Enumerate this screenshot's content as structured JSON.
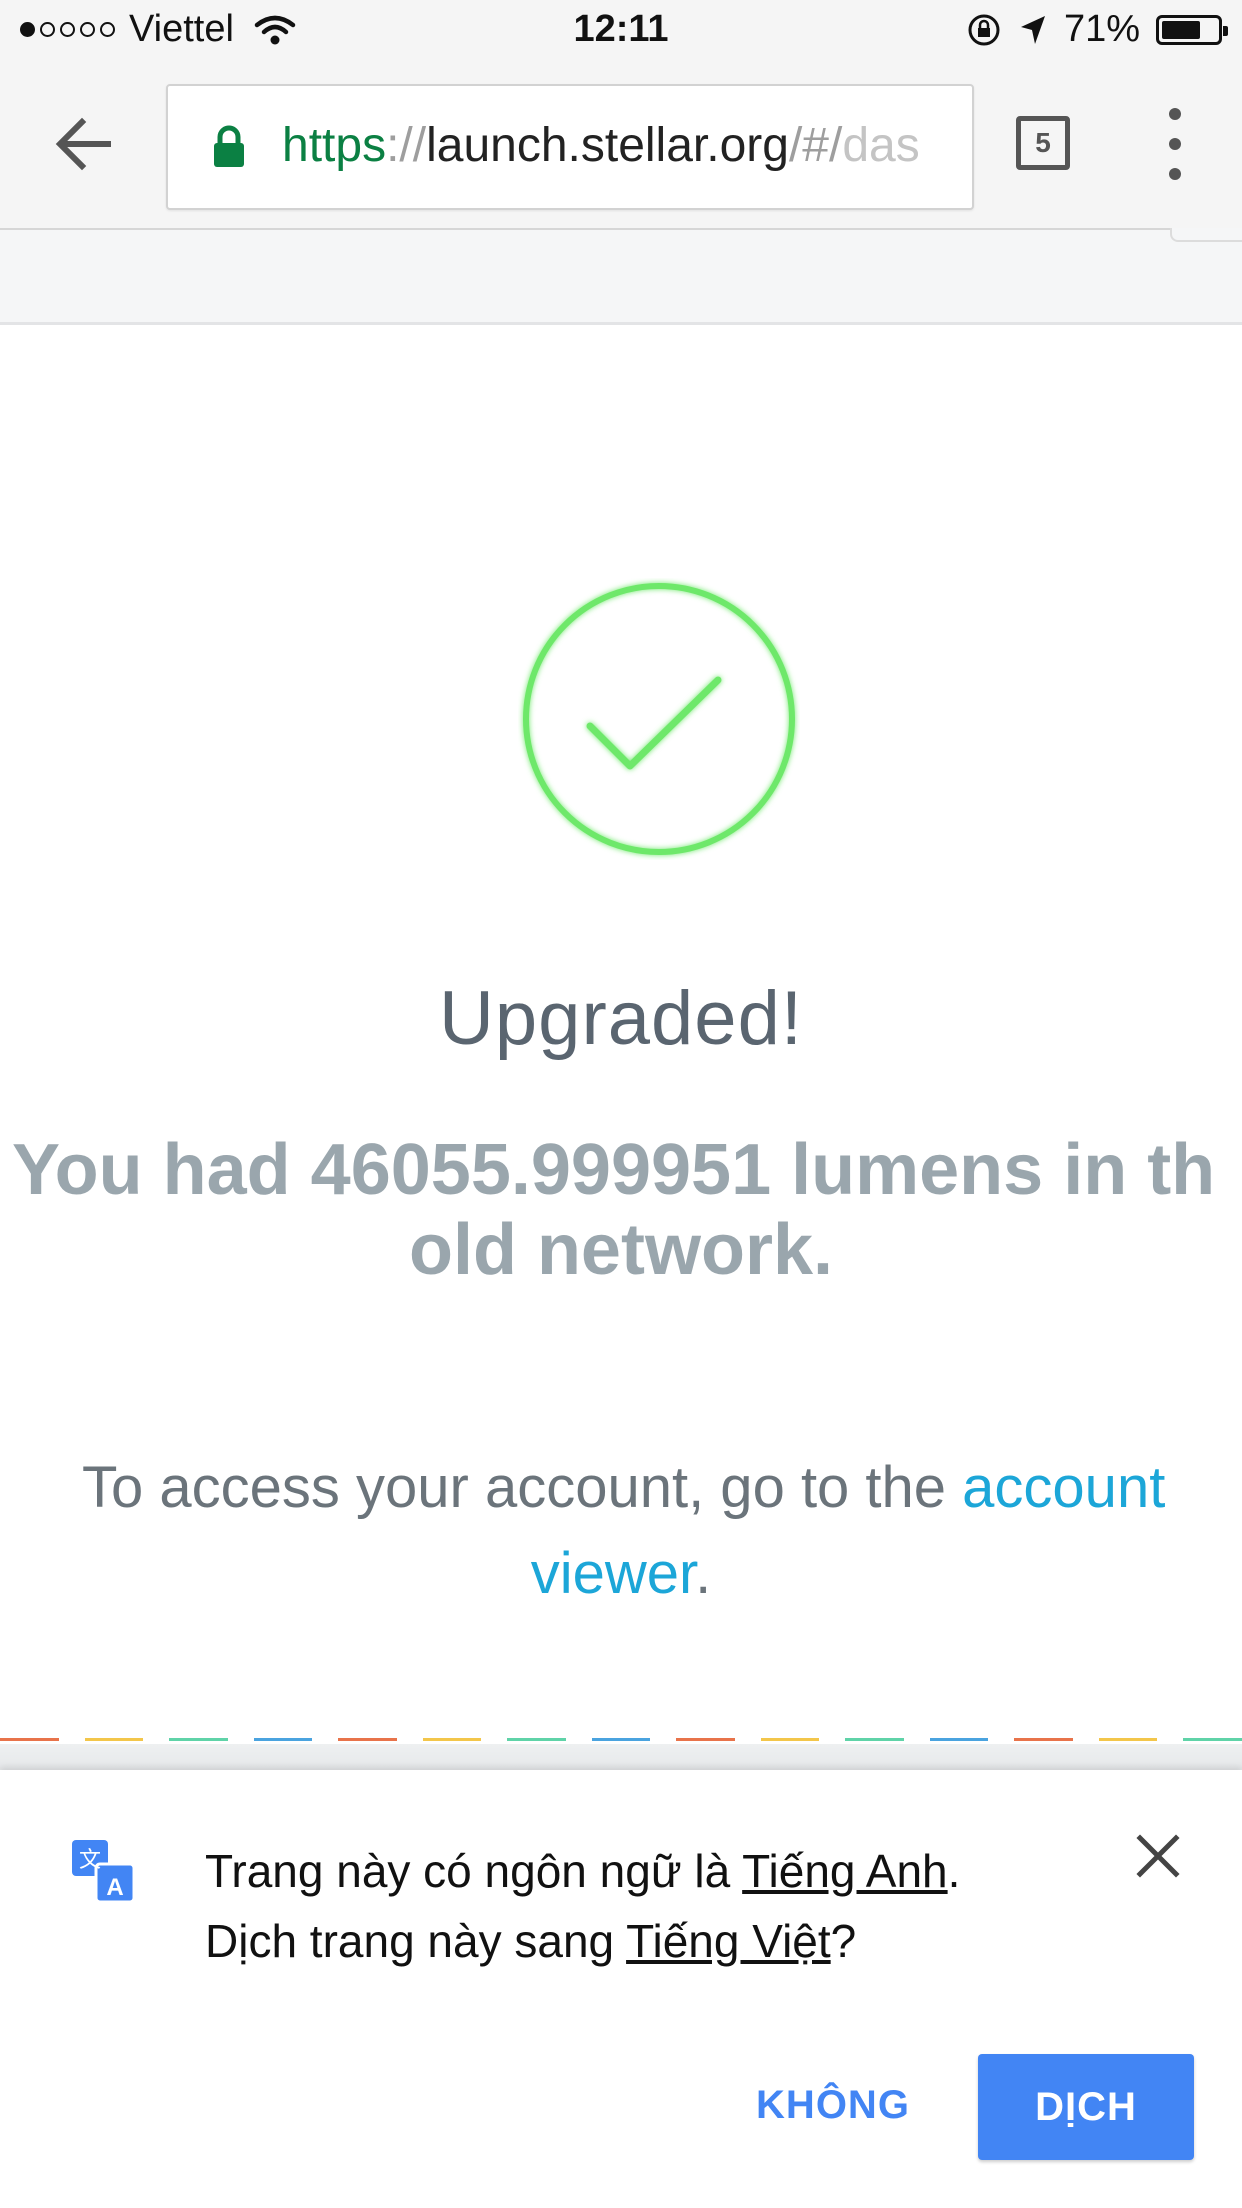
{
  "status_bar": {
    "carrier": "Viettel",
    "time": "12:11",
    "battery": "71%",
    "battery_level": 0.71,
    "signal_bars_filled": 1,
    "signal_bars_total": 5
  },
  "browser": {
    "url_scheme": "https",
    "url_sep1": "://",
    "url_host": "launch.stellar.org",
    "url_sep2": "/#/",
    "url_path": "das",
    "tab_count": "5"
  },
  "page": {
    "title": "Upgraded!",
    "balance_line1": "You had 46055.999951 lumens in th",
    "balance_line2": "old network.",
    "access_prefix": "To access your account, go to the ",
    "access_link1": "account",
    "access_link2": "viewer",
    "access_suffix": ".",
    "accent_color": "#6ee86a",
    "link_color": "#1ca6d8"
  },
  "stripe_colors": [
    "#e8734a",
    "#f3c64a",
    "#5fd3a8",
    "#4aa3df",
    "#e8734a",
    "#f3c64a",
    "#5fd3a8",
    "#4aa3df",
    "#e8734a",
    "#f3c64a",
    "#5fd3a8",
    "#4aa3df",
    "#e8734a",
    "#f3c64a",
    "#5fd3a8"
  ],
  "translate": {
    "line1_prefix": "Trang này có ngôn ngữ là ",
    "source_language": "Tiếng Anh",
    "line1_suffix": ".",
    "line2_prefix": "Dịch trang này sang ",
    "target_language": "Tiếng Việt",
    "line2_suffix": "?",
    "no_label": "KHÔNG",
    "yes_label": "DỊCH"
  }
}
